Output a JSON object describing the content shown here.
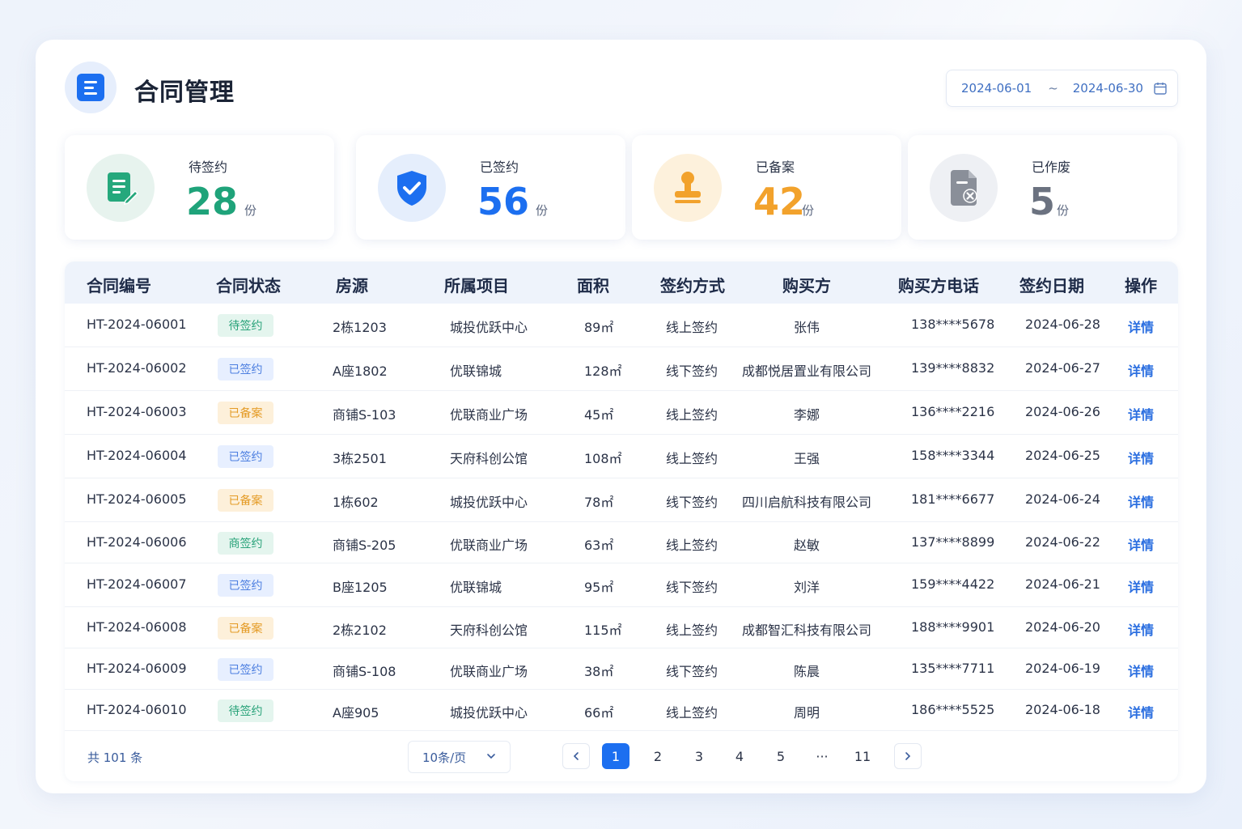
{
  "header": {
    "title": "合同管理",
    "date_start": "2024-06-01",
    "date_sep": "~",
    "date_end": "2024-06-30"
  },
  "stats": [
    {
      "label": "待签约",
      "value": "28",
      "unit": "份",
      "color": "#1fa37a",
      "icon": "contract-edit-icon"
    },
    {
      "label": "已签约",
      "value": "56",
      "unit": "份",
      "color": "#1c6ff0",
      "icon": "shield-check-icon"
    },
    {
      "label": "已备案",
      "value": "42",
      "unit": "份",
      "color": "#f2a22c",
      "icon": "stamp-icon"
    },
    {
      "label": "已作废",
      "value": "5",
      "unit": "份",
      "color": "#6b7280",
      "icon": "void-document-icon"
    }
  ],
  "table": {
    "headers": [
      "合同编号",
      "合同状态",
      "房源",
      "所属项目",
      "面积",
      "签约方式",
      "购买方",
      "购买方电话",
      "签约日期",
      "操作"
    ],
    "rows": [
      {
        "id": "HT-2024-06001",
        "status": "待签约",
        "status_type": "pending",
        "house": "2栋1203",
        "project": "城投优跃中心",
        "area": "89㎡",
        "method": "线上签约",
        "buyer": "张伟",
        "phone": "138****5678",
        "date": "2024-06-28",
        "action": "详情"
      },
      {
        "id": "HT-2024-06002",
        "status": "已签约",
        "status_type": "signed",
        "house": "A座1802",
        "project": "优联锦城",
        "area": "128㎡",
        "method": "线下签约",
        "buyer": "成都悦居置业有限公司",
        "phone": "139****8832",
        "date": "2024-06-27",
        "action": "详情"
      },
      {
        "id": "HT-2024-06003",
        "status": "已备案",
        "status_type": "filed",
        "house": "商铺S-103",
        "project": "优联商业广场",
        "area": "45㎡",
        "method": "线上签约",
        "buyer": "李娜",
        "phone": "136****2216",
        "date": "2024-06-26",
        "action": "详情"
      },
      {
        "id": "HT-2024-06004",
        "status": "已签约",
        "status_type": "signed",
        "house": "3栋2501",
        "project": "天府科创公馆",
        "area": "108㎡",
        "method": "线上签约",
        "buyer": "王强",
        "phone": "158****3344",
        "date": "2024-06-25",
        "action": "详情"
      },
      {
        "id": "HT-2024-06005",
        "status": "已备案",
        "status_type": "filed",
        "house": "1栋602",
        "project": "城投优跃中心",
        "area": "78㎡",
        "method": "线下签约",
        "buyer": "四川启航科技有限公司",
        "phone": "181****6677",
        "date": "2024-06-24",
        "action": "详情"
      },
      {
        "id": "HT-2024-06006",
        "status": "商签约",
        "status_type": "pending",
        "house": "商铺S-205",
        "project": "优联商业广场",
        "area": "63㎡",
        "method": "线上签约",
        "buyer": "赵敏",
        "phone": "137****8899",
        "date": "2024-06-22",
        "action": "详情"
      },
      {
        "id": "HT-2024-06007",
        "status": "已签约",
        "status_type": "signed",
        "house": "B座1205",
        "project": "优联锦城",
        "area": "95㎡",
        "method": "线下签约",
        "buyer": "刘洋",
        "phone": "159****4422",
        "date": "2024-06-21",
        "action": "详情"
      },
      {
        "id": "HT-2024-06008",
        "status": "已备案",
        "status_type": "filed",
        "house": "2栋2102",
        "project": "天府科创公馆",
        "area": "115㎡",
        "method": "线上签约",
        "buyer": "成都智汇科技有限公司",
        "phone": "188****9901",
        "date": "2024-06-20",
        "action": "详情"
      },
      {
        "id": "HT-2024-06009",
        "status": "已签约",
        "status_type": "signed",
        "house": "商铺S-108",
        "project": "优联商业广场",
        "area": "38㎡",
        "method": "线下签约",
        "buyer": "陈晨",
        "phone": "135****7711",
        "date": "2024-06-19",
        "action": "详情"
      },
      {
        "id": "HT-2024-06010",
        "status": "待签约",
        "status_type": "pending",
        "house": "A座905",
        "project": "城投优跃中心",
        "area": "66㎡",
        "method": "线上签约",
        "buyer": "周明",
        "phone": "186****5525",
        "date": "2024-06-18",
        "action": "详情"
      }
    ]
  },
  "pagination": {
    "total_text": "共 101 条",
    "page_size": "10条/页",
    "pages": [
      "1",
      "2",
      "3",
      "4",
      "5",
      "···",
      "11"
    ],
    "current": "1"
  }
}
